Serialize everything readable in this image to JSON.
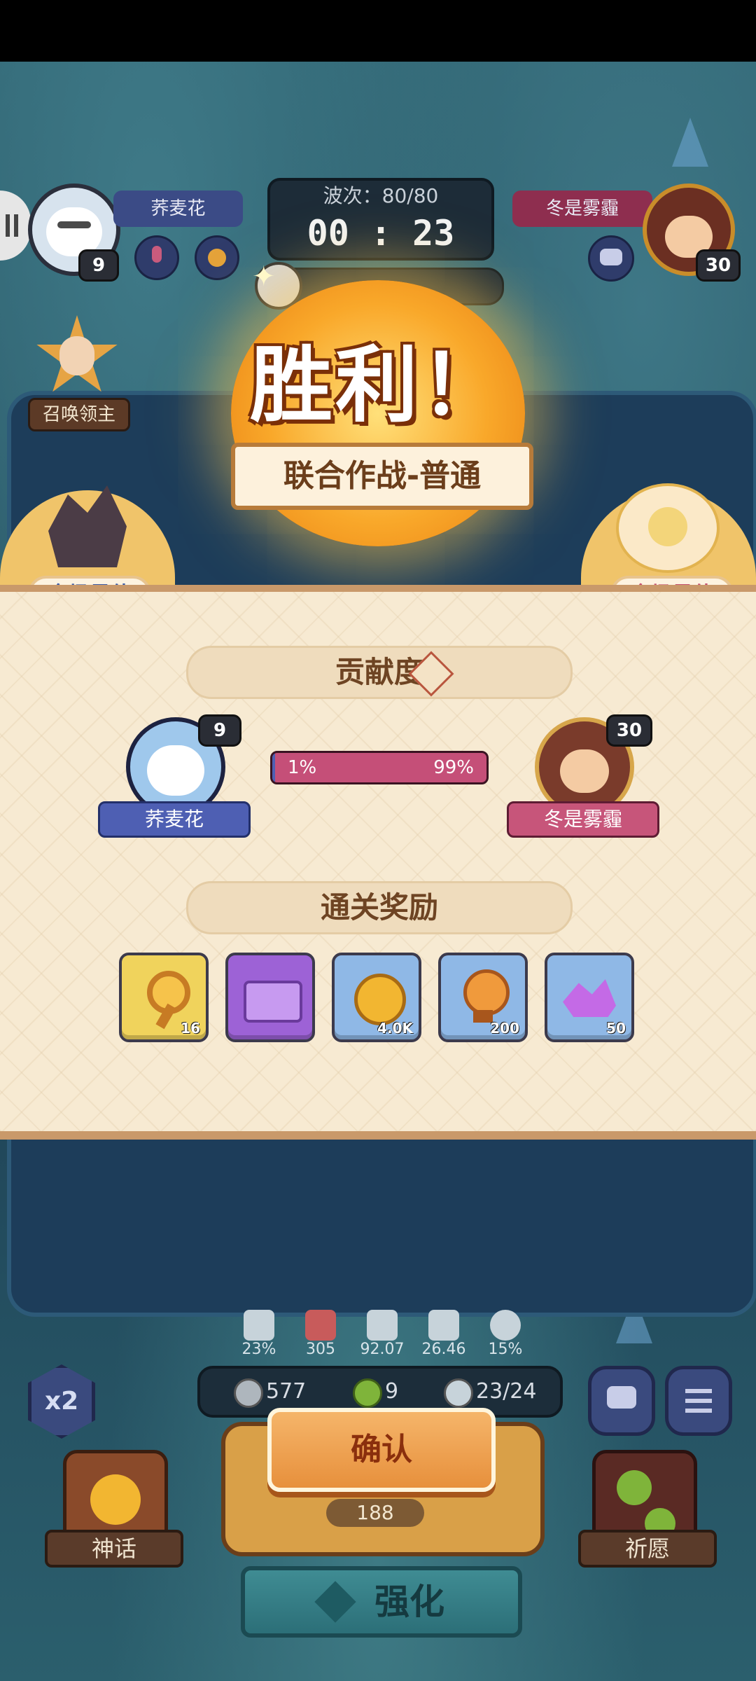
{
  "hud": {
    "player_left": {
      "name": "荞麦花",
      "level": "9"
    },
    "player_right": {
      "name": "冬是雾霾",
      "level": "30"
    },
    "wave_label": "波次：80/80",
    "timer": "00 : 23",
    "summon_lord_label": "召唤领主"
  },
  "victory": {
    "title": "胜利！",
    "mode": "联合作战-普通",
    "best_left": "全场最佳",
    "best_right": "全场最佳"
  },
  "contribution": {
    "title": "贡献度",
    "left": {
      "name": "荞麦花",
      "level": "9",
      "percent": "1%"
    },
    "right": {
      "name": "冬是雾霾",
      "level": "30",
      "percent": "99%"
    },
    "left_fraction": 0.01
  },
  "rewards": {
    "title": "通关奖励",
    "items": [
      {
        "icon": "key-icon",
        "qty": "16",
        "bg": "#f0d35c"
      },
      {
        "icon": "chest-icon",
        "qty": "",
        "bg": "#9d62d6"
      },
      {
        "icon": "gold-coin-icon",
        "qty": "4.0K",
        "bg": "#8fb8e6"
      },
      {
        "icon": "trophy-icon",
        "qty": "200",
        "bg": "#8fb8e6"
      },
      {
        "icon": "purple-crystal-icon",
        "qty": "50",
        "bg": "#8fb8e6"
      }
    ]
  },
  "bottom": {
    "stats": [
      "23%",
      "305",
      "92.07",
      "26.46",
      "15%"
    ],
    "resources": {
      "silver": "577",
      "clover": "9",
      "units": "23/24"
    },
    "speed_label": "x2",
    "confirm_label": "确认",
    "cost": "188",
    "strengthen_label": "强化",
    "myth_label": "神话",
    "wish_label": "祈愿"
  },
  "colors": {
    "accent_orange": "#e7903c",
    "left_team": "#4e5fb3",
    "right_team": "#c7557a"
  }
}
